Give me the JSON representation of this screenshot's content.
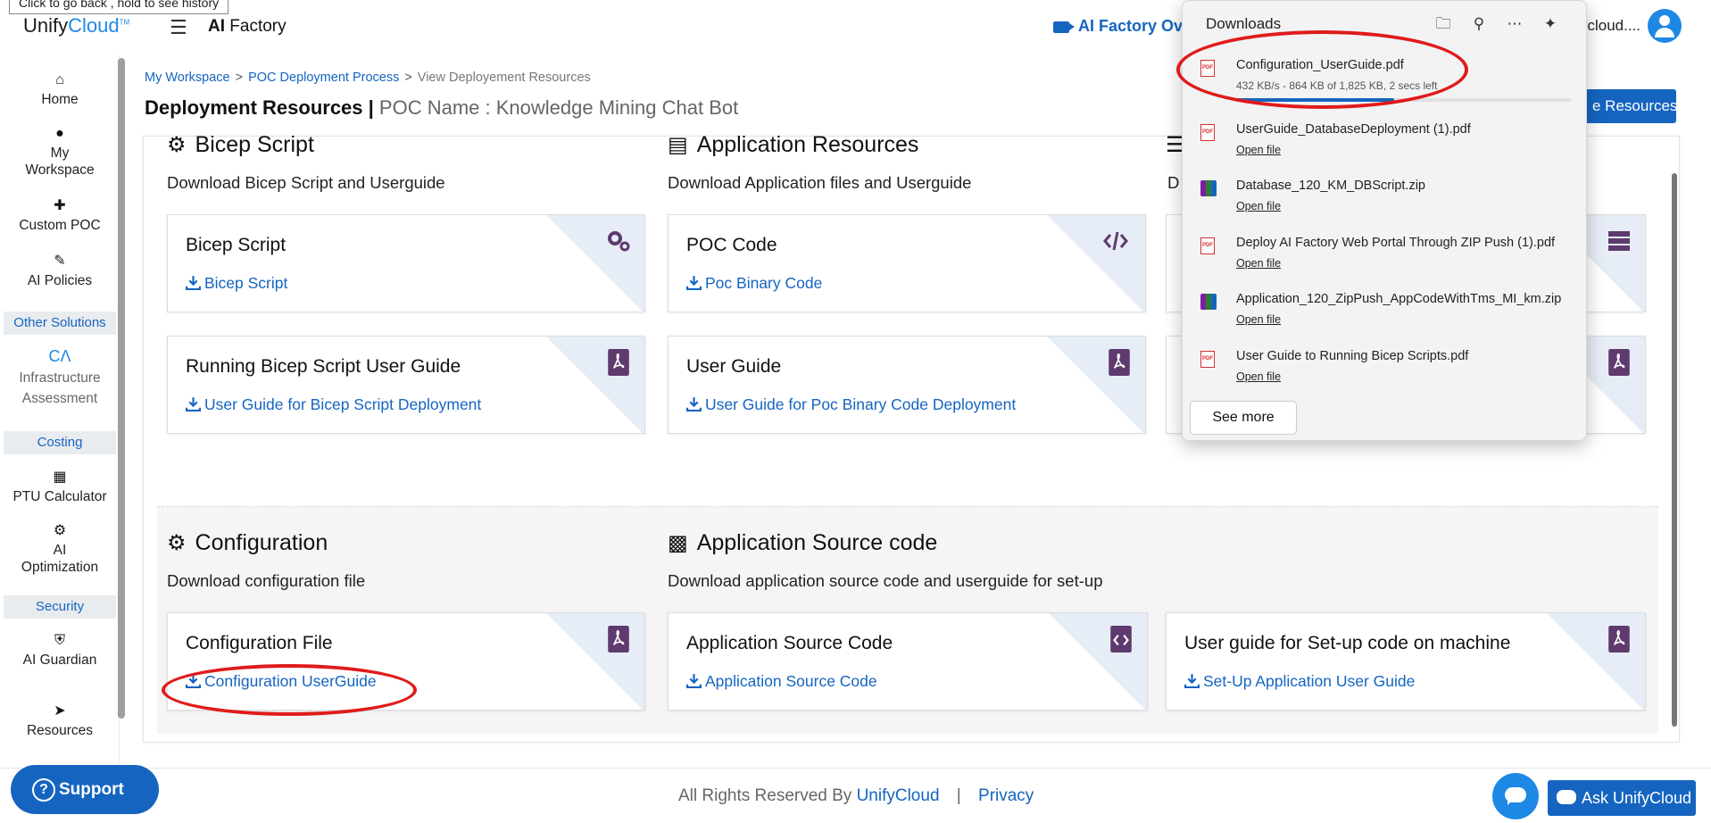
{
  "tooltip": "Click to go back , hold to see history",
  "header": {
    "brand_prefix": "Unify",
    "brand_suffix": "Cloud",
    "brand_tm": "TM",
    "app_bold": "AI",
    "app_rest": " Factory",
    "overview_link": "AI Factory Ove",
    "user_name": "ycloud...."
  },
  "sidebar": {
    "items": [
      {
        "label": "Home",
        "icon": "home-icon"
      },
      {
        "label": "My Workspace",
        "icon": "user-icon"
      },
      {
        "label": "Custom POC",
        "icon": "plus-icon"
      },
      {
        "label": "AI Policies",
        "icon": "policy-icon"
      },
      {
        "label": "Infrastructure Assessment",
        "icon": "ca-logo-icon"
      },
      {
        "label": "PTU Calculator",
        "icon": "calculator-icon"
      },
      {
        "label": "AI Optimization",
        "icon": "gears-icon"
      },
      {
        "label": "AI Guardian",
        "icon": "shield-icon"
      },
      {
        "label": "Resources",
        "icon": "rocket-icon"
      }
    ],
    "headers": {
      "other_solutions": "Other Solutions",
      "costing": "Costing",
      "security": "Security"
    }
  },
  "breadcrumb": {
    "items": [
      "My Workspace",
      "POC Deployment Process",
      "View Deployement Resources"
    ],
    "separator": ">"
  },
  "page": {
    "title": "Deployment Resources |",
    "poc_name": "POC Name : Knowledge Mining Chat Bot",
    "resources_button": "e Resources"
  },
  "sections": {
    "bicep": {
      "title": "Bicep Script",
      "subtitle": "Download Bicep Script and Userguide"
    },
    "app_resources": {
      "title": "Application Resources",
      "subtitle": "Download Application files and Userguide"
    },
    "third": {
      "subtitle": "D"
    },
    "configuration": {
      "title": "Configuration",
      "subtitle": "Download configuration file"
    },
    "app_source": {
      "title": "Application Source code",
      "subtitle": "Download application source code and userguide for set-up"
    }
  },
  "cards": {
    "bicep_script": {
      "title": "Bicep Script",
      "link": "Bicep Script"
    },
    "bicep_guide": {
      "title": "Running Bicep Script User Guide",
      "link": "User Guide for Bicep Script Deployment"
    },
    "poc_code": {
      "title": "POC Code",
      "link": "Poc Binary Code"
    },
    "user_guide": {
      "title": "User Guide",
      "link": "User Guide for Poc Binary Code Deployment"
    },
    "config_file": {
      "title": "Configuration File",
      "link": "Configuration UserGuide"
    },
    "app_source_code": {
      "title": "Application Source Code",
      "link": "Application Source Code"
    },
    "setup_guide": {
      "title": "User guide for Set-up code on machine",
      "link": "Set-Up Application User Guide"
    }
  },
  "downloads": {
    "title": "Downloads",
    "active": {
      "name": "Configuration_UserGuide.pdf",
      "status": "432 KB/s - 864 KB of 1,825 KB, 2 secs left",
      "progress": 0.47
    },
    "items": [
      {
        "name": "UserGuide_DatabaseDeployment (1).pdf",
        "type": "pdf",
        "action": "Open file"
      },
      {
        "name": "Database_120_KM_DBScript.zip",
        "type": "zip",
        "action": "Open file"
      },
      {
        "name": "Deploy AI Factory Web Portal Through ZIP Push (1).pdf",
        "type": "pdf",
        "action": "Open file"
      },
      {
        "name": "Application_120_ZipPush_AppCodeWithTms_MI_km.zip",
        "type": "zip",
        "action": "Open file"
      },
      {
        "name": "User Guide to Running Bicep Scripts.pdf",
        "type": "pdf",
        "action": "Open file"
      }
    ],
    "see_more": "See more",
    "pdf_badge": "PDF"
  },
  "footer": {
    "text": "All Rights Reserved By",
    "brand": "UnifyCloud",
    "separator": "|",
    "privacy": "Privacy",
    "support": "Support",
    "ask": "Ask UnifyCloud"
  },
  "colors": {
    "accent": "#1565c0",
    "highlight_ring": "#e01b1b",
    "card_corner": "#e6edf6",
    "icon_purple": "#5e3a6e"
  }
}
